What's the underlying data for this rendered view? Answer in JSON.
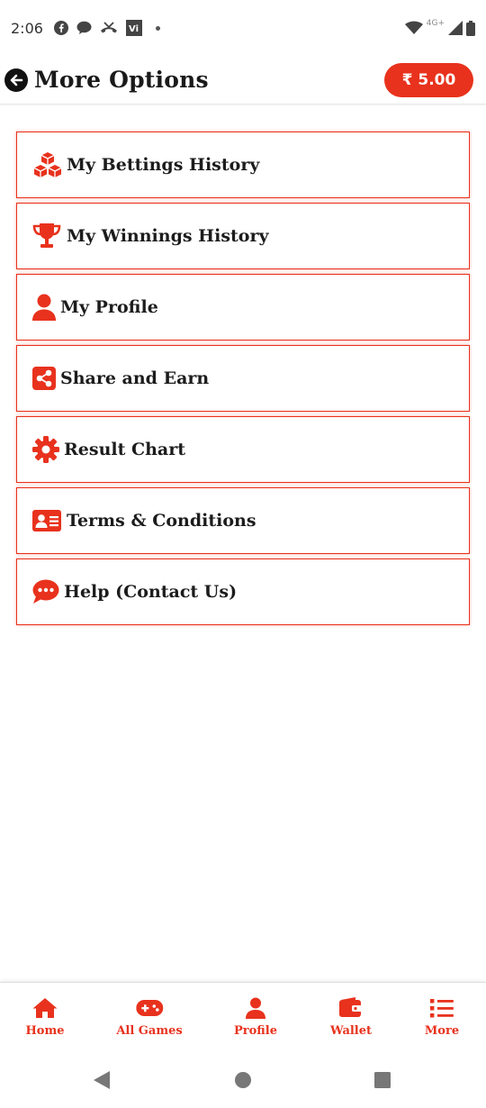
{
  "status_bar": {
    "time": "2:06",
    "network": "4G+"
  },
  "header": {
    "title": "More Options",
    "balance": "₹ 5.00"
  },
  "menu": {
    "items": [
      {
        "label": "My Bettings History",
        "icon": "cubes-icon"
      },
      {
        "label": "My Winnings History",
        "icon": "trophy-icon"
      },
      {
        "label": "My Profile",
        "icon": "user-icon"
      },
      {
        "label": "Share and Earn",
        "icon": "share-icon"
      },
      {
        "label": "Result Chart",
        "icon": "gear-icon"
      },
      {
        "label": "Terms & Conditions",
        "icon": "id-card-icon"
      },
      {
        "label": "Help (Contact Us)",
        "icon": "chat-icon"
      }
    ]
  },
  "bottom_nav": {
    "items": [
      {
        "label": "Home",
        "icon": "home-icon"
      },
      {
        "label": "All Games",
        "icon": "gamepad-icon"
      },
      {
        "label": "Profile",
        "icon": "user-icon"
      },
      {
        "label": "Wallet",
        "icon": "wallet-icon"
      },
      {
        "label": "More",
        "icon": "list-icon"
      }
    ]
  },
  "colors": {
    "accent": "#e8321d",
    "text": "#1a1a1a"
  }
}
